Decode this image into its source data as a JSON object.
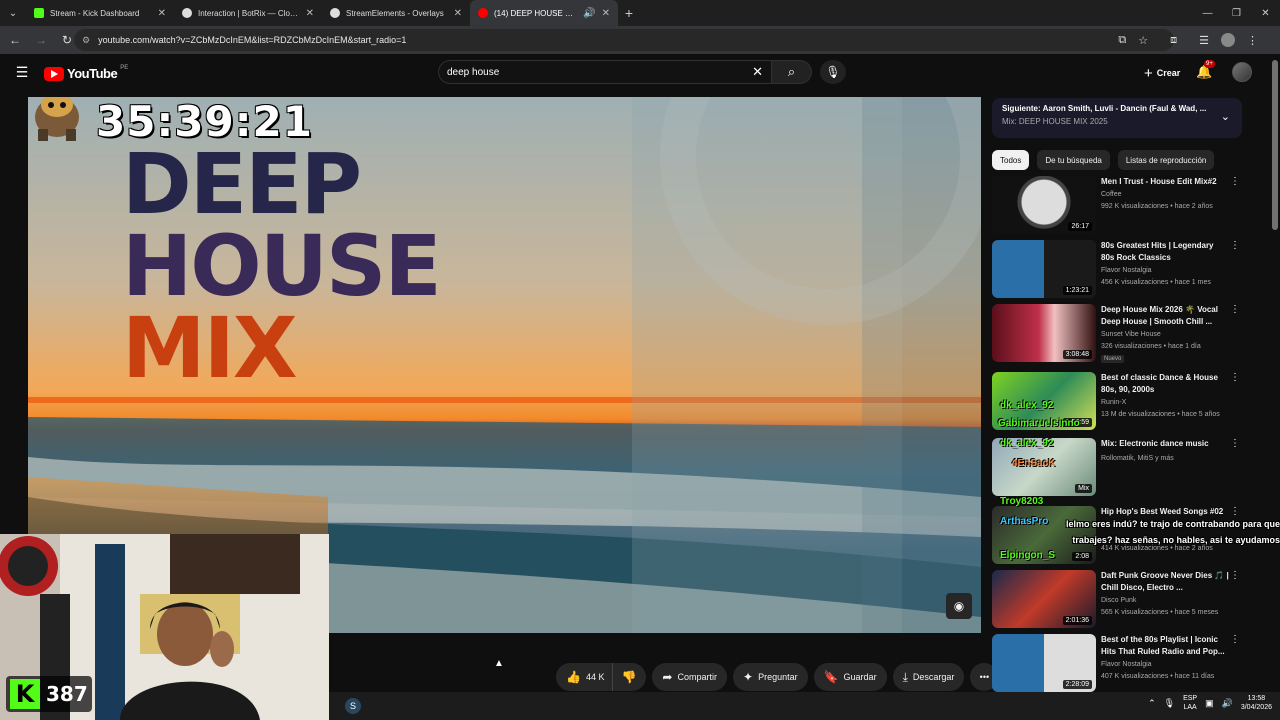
{
  "browser": {
    "tabs": [
      {
        "title": "Stream - Kick Dashboard",
        "favicon_color": "#53fc18",
        "active": false
      },
      {
        "title": "Interaction | BotRix — Cloud St",
        "favicon_color": "#dddddd",
        "active": false
      },
      {
        "title": "StreamElements - Overlays",
        "favicon_color": "#dddddd",
        "active": false
      },
      {
        "title": "(14) DEEP HOUSE MIX 2025",
        "favicon_color": "#ff0000",
        "active": true
      }
    ],
    "url": "youtube.com/watch?v=ZCbMzDcInEM&list=RDZCbMzDcInEM&start_radio=1"
  },
  "youtube": {
    "logo_text": "YouTube",
    "logo_region": "PE",
    "search_value": "deep house",
    "create_label": "Crear",
    "notif_count": "9+"
  },
  "video": {
    "overlay_timer": "35:39:21",
    "title_line1": "DEEP",
    "title_line2": "HOUSE",
    "title_line3": "MIX"
  },
  "actions": {
    "like_count": "44 K",
    "share": "Compartir",
    "ask": "Preguntar",
    "save": "Guardar",
    "download": "Descargar"
  },
  "up_next": {
    "title": "Siguiente: Aaron Smith, Luvli - Dancin (Faul & Wad, ...",
    "subtitle": "Mix: DEEP HOUSE MIX 2025"
  },
  "filters": [
    "Todos",
    "De tu búsqueda",
    "Listas de reproducción"
  ],
  "recommendations": [
    {
      "title": "Men I Trust - House Edit Mix#2",
      "channel": "Coffee",
      "meta": "992 K visualizaciones • hace 2 años",
      "duration": "26:17",
      "badge": ""
    },
    {
      "title": "80s Greatest Hits | Legendary 80s Rock Classics",
      "channel": "Flavor Nostalgia",
      "meta": "456 K visualizaciones • hace 1 mes",
      "duration": "1:23:21",
      "badge": ""
    },
    {
      "title": "Deep House Mix 2026 🌴 Vocal Deep House | Smooth Chill ...",
      "channel": "Sunset Vibe House",
      "meta": "326 visualizaciones • hace 1 día",
      "duration": "3:08:48",
      "badge": "Nuevo"
    },
    {
      "title": "Best of classic Dance & House 80s, 90, 2000s",
      "channel": "Runin-X",
      "meta": "13 M de visualizaciones • hace 5 años",
      "duration": "1:56:59",
      "badge": ""
    },
    {
      "title": "Mix: Electronic dance music",
      "channel": "Rollomatik, MitiS y más",
      "meta": "",
      "duration": "Mix",
      "badge": ""
    },
    {
      "title": "Hip Hop's Best Weed Songs #02",
      "channel": "",
      "meta": "414 K visualizaciones • hace 2 años",
      "duration": "2:08",
      "badge": ""
    },
    {
      "title": "Daft Punk Groove Never Dies 🎵 | Chill Disco, Electro ...",
      "channel": "Disco Punk",
      "meta": "565 K visualizaciones • hace 5 meses",
      "duration": "2:01:36",
      "badge": ""
    },
    {
      "title": "Best of the 80s Playlist | Iconic Hits That Ruled Radio and Pop...",
      "channel": "Flavor Nostalgia",
      "meta": "407 K visualizaciones • hace 11 días",
      "duration": "2:28:09",
      "badge": ""
    }
  ],
  "stream_overlay": {
    "viewer_count": "387",
    "names": [
      "dk_alex_92",
      "Gabimaruelsinno",
      "dk_alex_92",
      "4EnSacK",
      "Troy8203",
      "ArthasPro",
      "Elpingon_S"
    ],
    "chat_message": "lelmo eres indú? te trajo de contrabando para que trabajes? haz señas, no hables, asi te ayudamos"
  },
  "taskbar": {
    "lang_top": "ESP",
    "lang_bottom": "LAA",
    "time": "13:58",
    "date": "3/04/2026"
  }
}
